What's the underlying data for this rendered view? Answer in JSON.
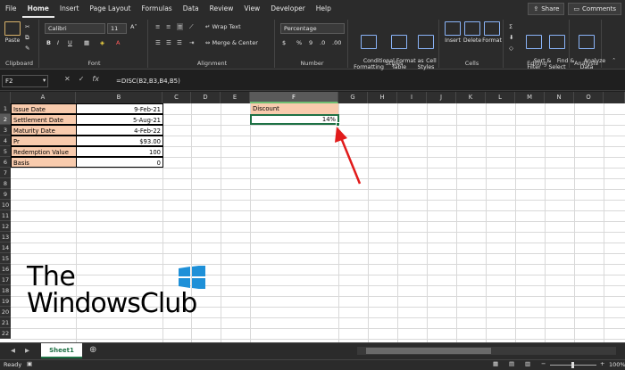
{
  "menu": {
    "tabs": [
      "File",
      "Home",
      "Insert",
      "Page Layout",
      "Formulas",
      "Data",
      "Review",
      "View",
      "Developer",
      "Help"
    ],
    "active": "Home",
    "share": "Share",
    "comments": "Comments"
  },
  "ribbon": {
    "clipboard": {
      "paste": "Paste",
      "label": "Clipboard"
    },
    "font": {
      "name": "Calibri",
      "size": "11",
      "label": "Font"
    },
    "alignment": {
      "wrap": "Wrap Text",
      "merge": "Merge & Center",
      "label": "Alignment"
    },
    "number": {
      "format": "Percentage",
      "label": "Number"
    },
    "styles": {
      "conditional": "Conditional\nFormatting",
      "format_table": "Format as\nTable",
      "cell_styles": "Cell\nStyles",
      "label": "Styles"
    },
    "cells": {
      "insert": "Insert",
      "delete": "Delete",
      "format": "Format",
      "label": "Cells"
    },
    "editing": {
      "sort": "Sort &\nFilter",
      "find": "Find &\nSelect",
      "label": "Editing"
    },
    "analysis": {
      "analyze": "Analyze\nData",
      "label": "Analysis"
    }
  },
  "formula_bar": {
    "name_box": "F2",
    "formula": "=DISC(B2,B3,B4,B5)"
  },
  "columns": [
    "A",
    "B",
    "C",
    "D",
    "E",
    "F",
    "G",
    "H",
    "I",
    "J",
    "K",
    "L",
    "M",
    "N",
    "O"
  ],
  "selected_column": "F",
  "rows": [
    "1",
    "2",
    "3",
    "4",
    "5",
    "6",
    "7",
    "8",
    "9",
    "10",
    "11",
    "12",
    "13",
    "14",
    "15",
    "16",
    "17",
    "18",
    "19",
    "20",
    "21",
    "22"
  ],
  "selected_row": "2",
  "cells": {
    "A1": "Issue Date",
    "B1": "9-Feb-21",
    "A2": "Settlement Date",
    "B2": "5-Aug-21",
    "A3": "Maturity Date",
    "B3": "4-Feb-22",
    "A4": "Pr",
    "B4": "$93.00",
    "A5": "Redemption Value",
    "B5": "100",
    "A6": "Basis",
    "B6": "0",
    "F1": "Discount",
    "F2": "14%"
  },
  "sheet_tab": "Sheet1",
  "status": {
    "ready": "Ready",
    "zoom": "100%"
  },
  "watermark": {
    "line1": "The",
    "line2": "WindowsClub"
  },
  "colors": {
    "peach": "#f8cbad",
    "excel_green": "#1e7145",
    "arrow_red": "#e11b1b"
  }
}
